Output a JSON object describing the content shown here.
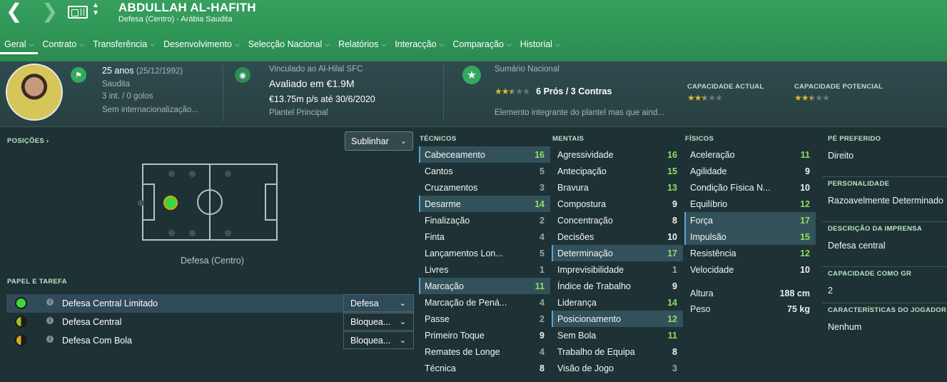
{
  "header": {
    "player_name": "ABDULLAH AL-HAFITH",
    "subtitle": "Defesa (Centro) - Arábia Saudita",
    "back_icon": "chevron-left-icon",
    "forward_icon": "chevron-right-icon"
  },
  "tabs": [
    {
      "label": "Geral"
    },
    {
      "label": "Contrato"
    },
    {
      "label": "Transferência"
    },
    {
      "label": "Desenvolvimento"
    },
    {
      "label": "Selecção Nacional"
    },
    {
      "label": "Relatórios"
    },
    {
      "label": "Interacção"
    },
    {
      "label": "Comparação"
    },
    {
      "label": "Historial"
    }
  ],
  "summary": {
    "age": "25 anos",
    "dob": "(25/12/1992)",
    "nationality": "Saudita",
    "caps": "3 int. / 0 golos",
    "intl_status": "Sem internacionalização...",
    "club_line": "Vinculado ao Al-Hilal SFC",
    "value": "Avaliado em €1.9M",
    "wage": "€13.75m p/s até 30/6/2020",
    "squad": "Plantel Principal",
    "report_title": "Sumário Nacional",
    "pros_cons": "6 Prós / 3 Contras",
    "report_text": "Elemento integrante do plantel mas que aind...",
    "report_stars": 2.5,
    "current_ability_label": "CAPACIDADE ACTUAL",
    "potential_ability_label": "CAPACIDADE POTENCIAL",
    "current_ability_stars": 2.5,
    "potential_ability_stars": 2.5
  },
  "positions": {
    "label": "POSIÇÕES",
    "dropdown": "Sublinhar",
    "position_name": "Defesa (Centro)"
  },
  "roles": {
    "label": "PAPEL E TAREFA",
    "items": [
      {
        "name": "Defesa Central Limitado",
        "duty": "Defesa",
        "color": "#3ed63a",
        "style": "full"
      },
      {
        "name": "Defesa Central",
        "duty": "Bloquea...",
        "color": "#9bbf1f",
        "style": "half"
      },
      {
        "name": "Defesa Com Bola",
        "duty": "Bloquea...",
        "color": "#d7a521",
        "style": "half"
      }
    ]
  },
  "attributes": {
    "technical": {
      "label": "TÉCNICOS",
      "items": [
        {
          "name": "Cabeceamento",
          "value": 16,
          "hl": true
        },
        {
          "name": "Cantos",
          "value": 5
        },
        {
          "name": "Cruzamentos",
          "value": 3
        },
        {
          "name": "Desarme",
          "value": 14,
          "hl": true
        },
        {
          "name": "Finalização",
          "value": 2
        },
        {
          "name": "Finta",
          "value": 4
        },
        {
          "name": "Lançamentos Lon...",
          "value": 5
        },
        {
          "name": "Livres",
          "value": 1
        },
        {
          "name": "Marcação",
          "value": 11,
          "hl": true
        },
        {
          "name": "Marcação de Pená...",
          "value": 4
        },
        {
          "name": "Passe",
          "value": 2
        },
        {
          "name": "Primeiro Toque",
          "value": 9
        },
        {
          "name": "Remates de Longe",
          "value": 4
        },
        {
          "name": "Técnica",
          "value": 8
        }
      ]
    },
    "mental": {
      "label": "MENTAIS",
      "items": [
        {
          "name": "Agressividade",
          "value": 16
        },
        {
          "name": "Antecipação",
          "value": 15
        },
        {
          "name": "Bravura",
          "value": 13
        },
        {
          "name": "Compostura",
          "value": 9
        },
        {
          "name": "Concentração",
          "value": 8
        },
        {
          "name": "Decisões",
          "value": 10
        },
        {
          "name": "Determinação",
          "value": 17,
          "hl": true
        },
        {
          "name": "Imprevisibilidade",
          "value": 1
        },
        {
          "name": "Índice de Trabalho",
          "value": 9
        },
        {
          "name": "Liderança",
          "value": 14
        },
        {
          "name": "Posicionamento",
          "value": 12,
          "hl": true
        },
        {
          "name": "Sem Bola",
          "value": 11
        },
        {
          "name": "Trabalho de Equipa",
          "value": 8
        },
        {
          "name": "Visão de Jogo",
          "value": 3
        }
      ]
    },
    "physical": {
      "label": "FÍSICOS",
      "items": [
        {
          "name": "Aceleração",
          "value": 11
        },
        {
          "name": "Agilidade",
          "value": 9
        },
        {
          "name": "Condição Física N...",
          "value": 10
        },
        {
          "name": "Equilíbrio",
          "value": 12
        },
        {
          "name": "Força",
          "value": 17,
          "hl": true
        },
        {
          "name": "Impulsão",
          "value": 15,
          "hl": true
        },
        {
          "name": "Resistência",
          "value": 12
        },
        {
          "name": "Velocidade",
          "value": 10
        }
      ]
    }
  },
  "body": {
    "height_label": "Altura",
    "height": "188 cm",
    "weight_label": "Peso",
    "weight": "75 kg"
  },
  "info": [
    {
      "label": "PÉ PREFERIDO",
      "value": "Direito"
    },
    {
      "label": "PERSONALIDADE",
      "value": "Razoavelmente Determinado"
    },
    {
      "label": "DESCRIÇÃO DA IMPRENSA",
      "value": "Defesa central"
    },
    {
      "label": "CAPACIDADE COMO GR",
      "value": "2"
    },
    {
      "label": "CARACTERÍSTICAS DO JOGADOR",
      "value": "Nenhum"
    }
  ]
}
